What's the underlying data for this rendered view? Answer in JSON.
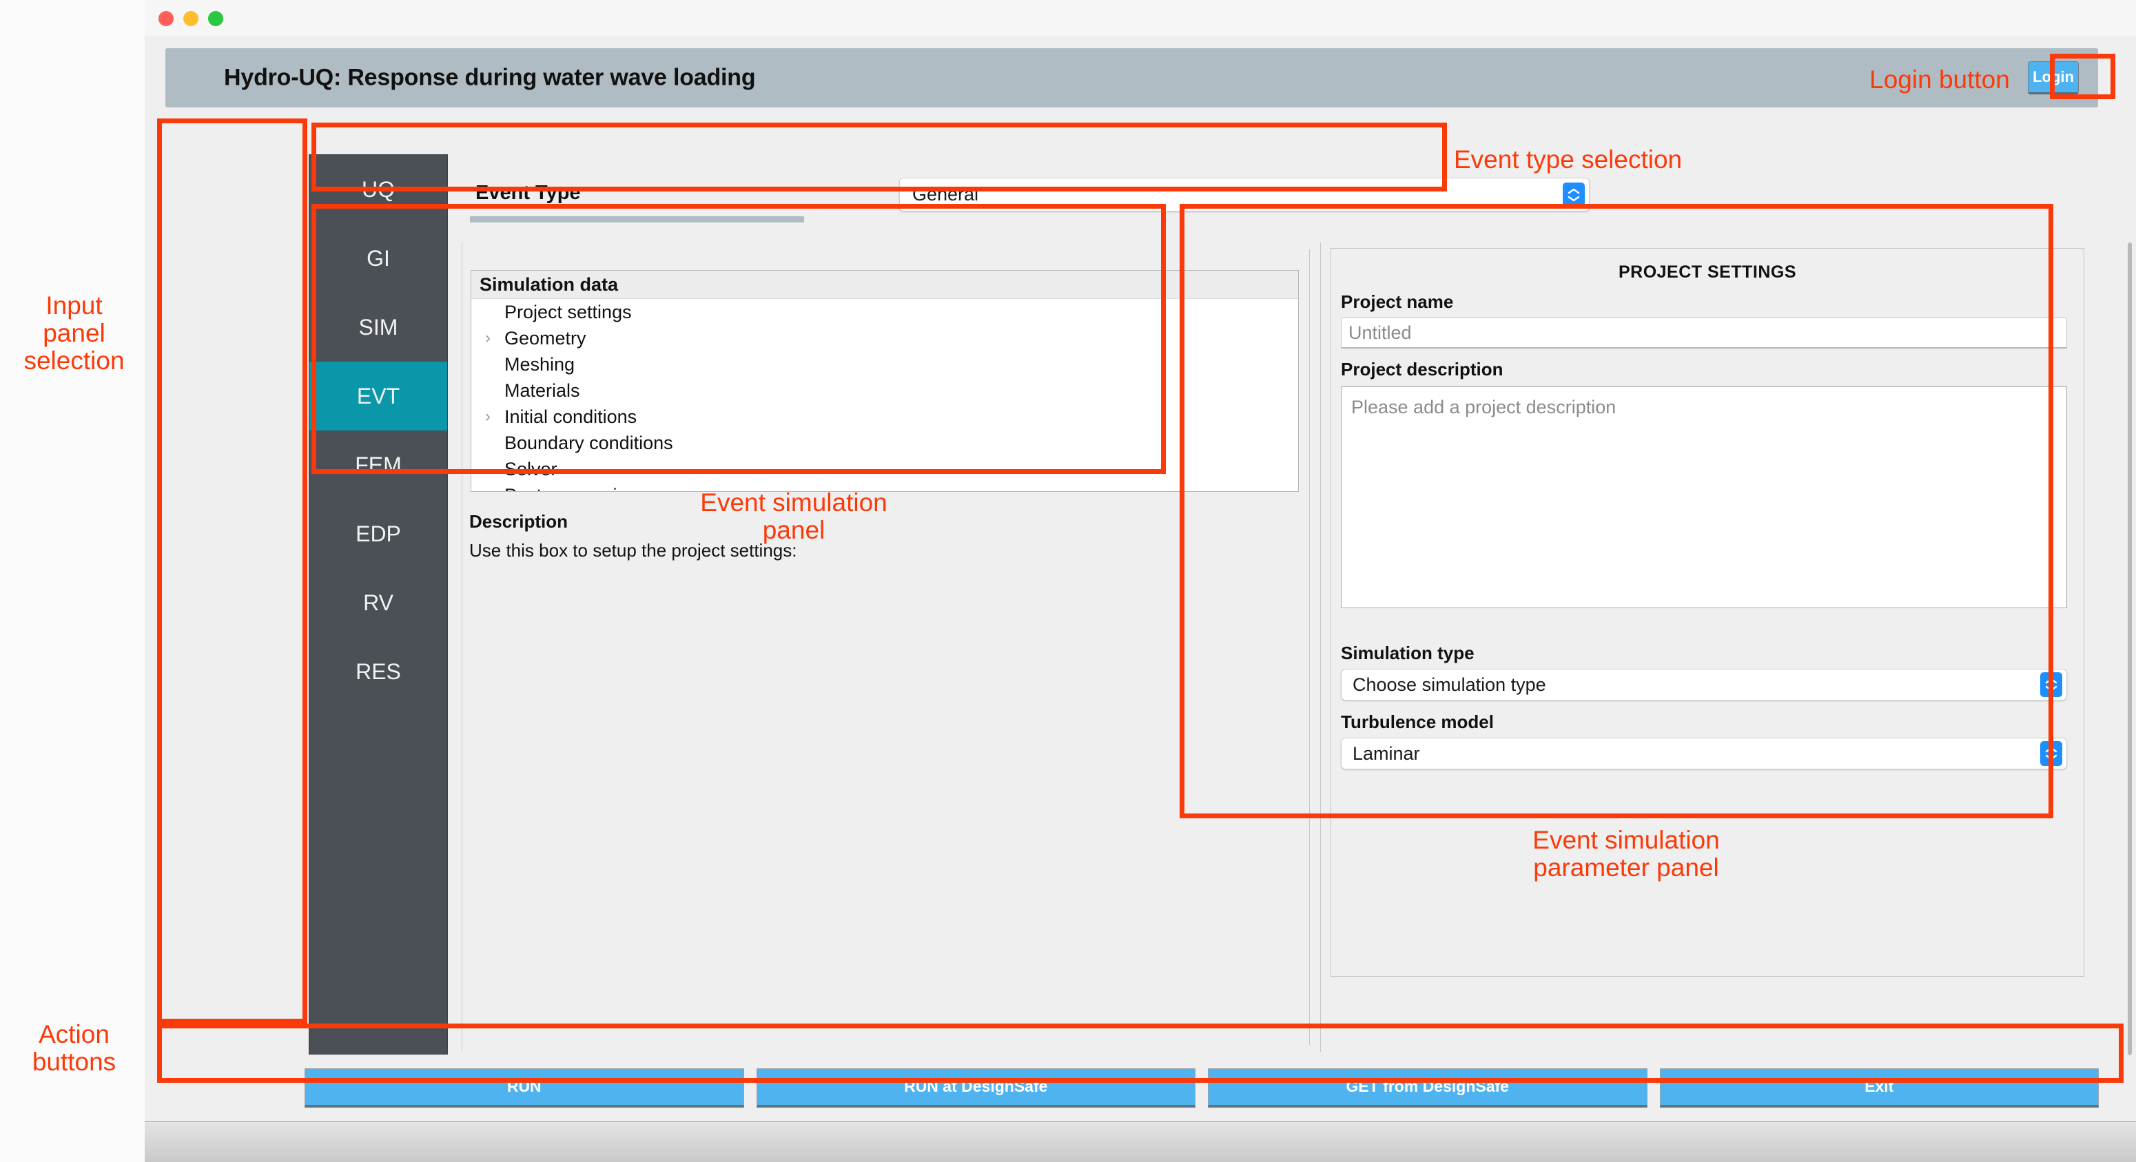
{
  "window": {
    "traffic_lights": [
      "close",
      "minimize",
      "maximize"
    ]
  },
  "header": {
    "title": "Hydro-UQ: Response during water wave loading",
    "login_label": "Login"
  },
  "sidebar": {
    "items": [
      {
        "label": "UQ",
        "active": false
      },
      {
        "label": "GI",
        "active": false
      },
      {
        "label": "SIM",
        "active": false
      },
      {
        "label": "EVT",
        "active": true
      },
      {
        "label": "FEM",
        "active": false
      },
      {
        "label": "EDP",
        "active": false
      },
      {
        "label": "RV",
        "active": false
      },
      {
        "label": "RES",
        "active": false
      }
    ],
    "active_color": "#0b97aa",
    "background_color": "#4b5057"
  },
  "event_type": {
    "label": "Event Type",
    "selected": "General",
    "options": [
      "General"
    ]
  },
  "simulation_panel": {
    "tree_header": "Simulation data",
    "tree_items": [
      {
        "label": "Project settings",
        "expandable": false
      },
      {
        "label": "Geometry",
        "expandable": true
      },
      {
        "label": "Meshing",
        "expandable": false
      },
      {
        "label": "Materials",
        "expandable": false
      },
      {
        "label": "Initial conditions",
        "expandable": true
      },
      {
        "label": "Boundary conditions",
        "expandable": false
      },
      {
        "label": "Solver",
        "expandable": false
      },
      {
        "label": "Post-processing",
        "expandable": false
      }
    ],
    "description_title": "Description",
    "description_text": "Use this box to setup the project settings:"
  },
  "project_settings": {
    "panel_title": "PROJECT SETTINGS",
    "project_name_label": "Project name",
    "project_name_placeholder": "Untitled",
    "project_description_label": "Project description",
    "project_description_placeholder": "Please add a project description",
    "simulation_type_label": "Simulation type",
    "simulation_type_selected": "Choose simulation type",
    "turbulence_model_label": "Turbulence model",
    "turbulence_model_selected": "Laminar"
  },
  "actions": {
    "buttons": [
      {
        "label": "RUN"
      },
      {
        "label": "RUN at DesignSafe"
      },
      {
        "label": "GET from DesignSafe"
      },
      {
        "label": "Exit"
      }
    ],
    "color": "#4fb3f0"
  },
  "annotations": {
    "color": "#fb3a0a",
    "labels": [
      {
        "id": "login",
        "text": "Login button"
      },
      {
        "id": "event_type",
        "text": "Event type selection"
      },
      {
        "id": "input_panel",
        "text": "Input\npanel\nselection"
      },
      {
        "id": "event_sim",
        "text": "Event simulation\npanel"
      },
      {
        "id": "event_param",
        "text": "Event simulation\nparameter panel"
      },
      {
        "id": "action",
        "text": "Action\nbuttons"
      }
    ]
  }
}
